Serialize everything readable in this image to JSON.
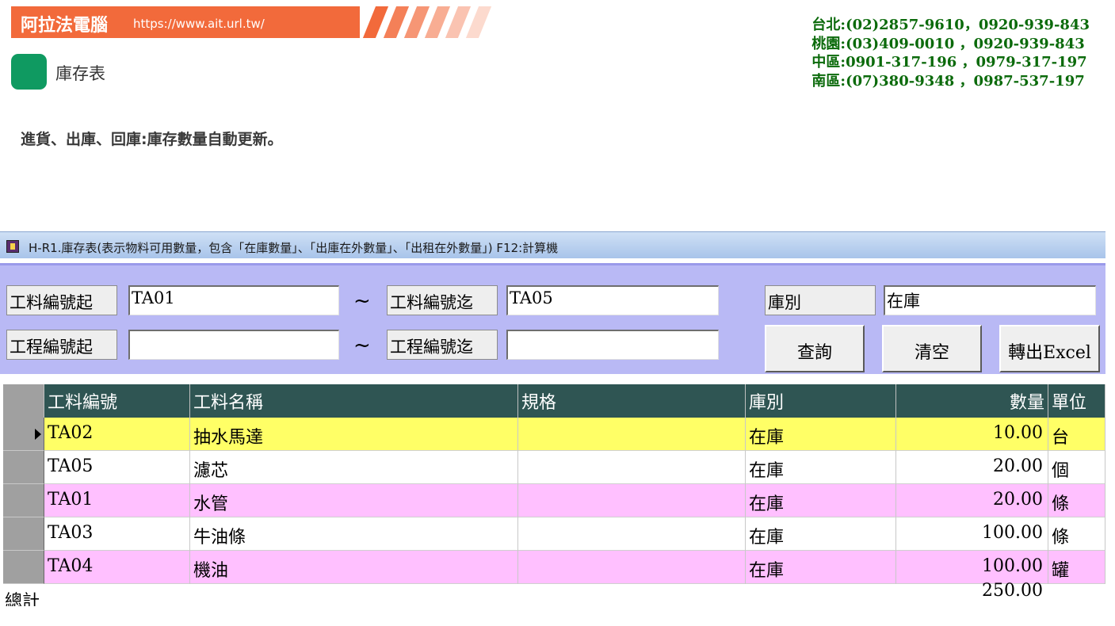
{
  "header": {
    "brand_name": "阿拉法電腦",
    "brand_url": "https://www.ait.url.tw/",
    "brand_color": "#f26a3b",
    "page_title": "庫存表",
    "description": "進貨、出庫、回庫:庫存數量自動更新。",
    "contacts": [
      "台北:(02)2857-9610，0920-939-843",
      "桃園:(03)409-0010 ，0920-939-843",
      "中區:0901-317-196 ，0979-317-197",
      "南區:(07)380-9348 ，0987-537-197"
    ]
  },
  "window": {
    "title": "H-R1.庫存表(表示物料可用數量，包含「在庫數量」、「出庫在外數量」、「出租在外數量」) F12:計算機"
  },
  "filters": {
    "material_from_label": "工料編號起",
    "material_from_value": "TA01",
    "material_to_label": "工料編號迄",
    "material_to_value": "TA05",
    "project_from_label": "工程編號起",
    "project_from_value": "",
    "project_to_label": "工程編號迄",
    "project_to_value": "",
    "tilde": "~",
    "warehouse_label": "庫別",
    "warehouse_value": "在庫",
    "query_button": "查詢",
    "clear_button": "清空",
    "export_button": "轉出Excel"
  },
  "grid": {
    "columns": [
      "工料編號",
      "工料名稱",
      "規格",
      "庫別",
      "數量",
      "單位"
    ],
    "rows": [
      {
        "code": "TA02",
        "name": "抽水馬達",
        "spec": "",
        "warehouse": "在庫",
        "qty": "10.00",
        "unit": "台",
        "bg": "#ffff66"
      },
      {
        "code": "TA05",
        "name": "濾芯",
        "spec": "",
        "warehouse": "在庫",
        "qty": "20.00",
        "unit": "個",
        "bg": "#ffffff"
      },
      {
        "code": "TA01",
        "name": "水管",
        "spec": "",
        "warehouse": "在庫",
        "qty": "20.00",
        "unit": "條",
        "bg": "#ffc0ff"
      },
      {
        "code": "TA03",
        "name": "牛油條",
        "spec": "",
        "warehouse": "在庫",
        "qty": "100.00",
        "unit": "條",
        "bg": "#ffffff"
      },
      {
        "code": "TA04",
        "name": "機油",
        "spec": "",
        "warehouse": "在庫",
        "qty": "100.00",
        "unit": "罐",
        "bg": "#ffc0ff"
      }
    ],
    "total_label": "總計",
    "total_value": "250.00"
  }
}
